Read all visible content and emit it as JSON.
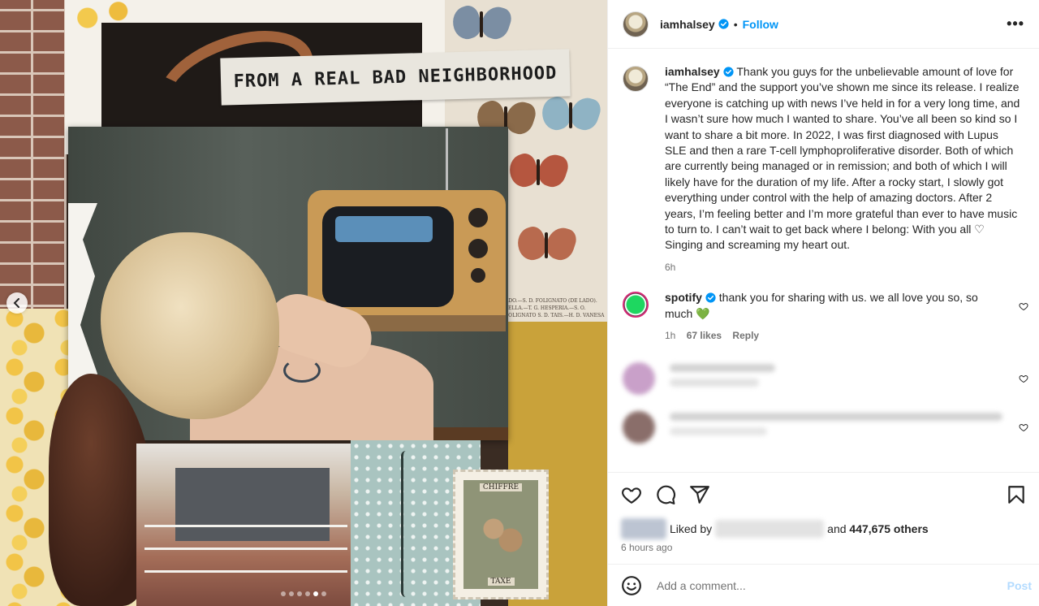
{
  "media": {
    "collage_title": "FROM A REAL BAD NEIGHBORHOOD",
    "caption_small": "ADO.—S. D. FOLIGNATO (DE LADO). TELLA.—T. G. HESPERIA.—S. O. FOLIGNATO S. D. TAIS.—H. D. VANESA",
    "stamp_top": "CHIFFRE",
    "stamp_bottom": "TAXE",
    "carousel_prev_glyph": "‹",
    "dots_count": 6,
    "active_dot": 4
  },
  "post_header": {
    "username": "iamhalsey",
    "separator": "•",
    "follow_label": "Follow",
    "more_label": "•••"
  },
  "caption": {
    "username": "iamhalsey",
    "text": "Thank you guys for the unbelievable amount of love for “The End” and the support you’ve shown me since its release. I realize everyone is catching up with news I’ve held in for a very long time, and I wasn’t sure how much I wanted to share. You’ve all been so kind so I want to share a bit more. In 2022, I was first diagnosed with Lupus SLE and then a rare T-cell lymphoproliferative disorder. Both of which are currently being managed or in remission; and both of which I will likely have for the duration of my life. After a rocky start, I slowly got everything under control with the help of amazing doctors. After 2 years, I’m feeling better and I’m more grateful than ever to have music to turn to. I can’t wait to get back where I belong: With you all ♡ Singing and screaming my heart out.",
    "time": "6h"
  },
  "comments": [
    {
      "username": "spotify",
      "text": "thank you for sharing with us. we all love you so, so much 💚",
      "time": "1h",
      "likes": "67 likes",
      "reply_label": "Reply"
    }
  ],
  "actions": {
    "liked_by_prefix": "Liked by",
    "likes_suffix_and": "and",
    "likes_count": "447,675 others",
    "timeago": "6 hours ago"
  },
  "add_comment": {
    "placeholder": "Add a comment...",
    "post_label": "Post"
  },
  "colors": {
    "accent": "#0095f6",
    "post_disabled": "#b3dbff",
    "secondary_text": "#737373",
    "spotify_green": "#1ed760"
  },
  "icons": [
    "verified-badge-icon",
    "more-options-icon",
    "heart-icon",
    "comment-icon",
    "share-icon",
    "bookmark-icon",
    "emoji-icon",
    "chevron-left-icon"
  ]
}
